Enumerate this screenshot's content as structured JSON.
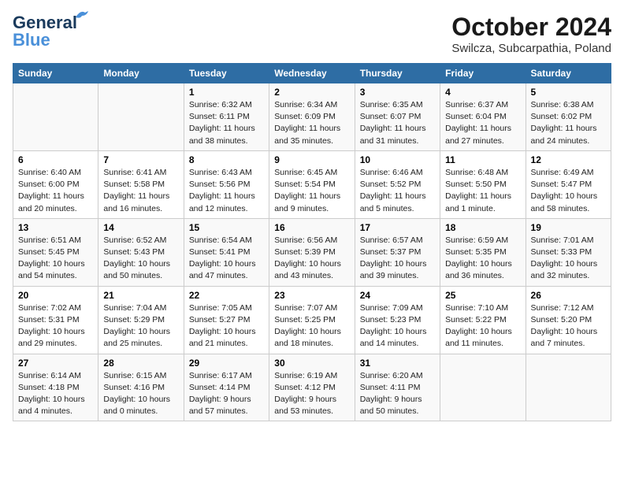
{
  "header": {
    "logo_line1": "General",
    "logo_line2": "Blue",
    "title": "October 2024",
    "subtitle": "Swilcza, Subcarpathia, Poland"
  },
  "days_of_week": [
    "Sunday",
    "Monday",
    "Tuesday",
    "Wednesday",
    "Thursday",
    "Friday",
    "Saturday"
  ],
  "weeks": [
    [
      {
        "day": "",
        "info": ""
      },
      {
        "day": "",
        "info": ""
      },
      {
        "day": "1",
        "info": "Sunrise: 6:32 AM\nSunset: 6:11 PM\nDaylight: 11 hours and 38 minutes."
      },
      {
        "day": "2",
        "info": "Sunrise: 6:34 AM\nSunset: 6:09 PM\nDaylight: 11 hours and 35 minutes."
      },
      {
        "day": "3",
        "info": "Sunrise: 6:35 AM\nSunset: 6:07 PM\nDaylight: 11 hours and 31 minutes."
      },
      {
        "day": "4",
        "info": "Sunrise: 6:37 AM\nSunset: 6:04 PM\nDaylight: 11 hours and 27 minutes."
      },
      {
        "day": "5",
        "info": "Sunrise: 6:38 AM\nSunset: 6:02 PM\nDaylight: 11 hours and 24 minutes."
      }
    ],
    [
      {
        "day": "6",
        "info": "Sunrise: 6:40 AM\nSunset: 6:00 PM\nDaylight: 11 hours and 20 minutes."
      },
      {
        "day": "7",
        "info": "Sunrise: 6:41 AM\nSunset: 5:58 PM\nDaylight: 11 hours and 16 minutes."
      },
      {
        "day": "8",
        "info": "Sunrise: 6:43 AM\nSunset: 5:56 PM\nDaylight: 11 hours and 12 minutes."
      },
      {
        "day": "9",
        "info": "Sunrise: 6:45 AM\nSunset: 5:54 PM\nDaylight: 11 hours and 9 minutes."
      },
      {
        "day": "10",
        "info": "Sunrise: 6:46 AM\nSunset: 5:52 PM\nDaylight: 11 hours and 5 minutes."
      },
      {
        "day": "11",
        "info": "Sunrise: 6:48 AM\nSunset: 5:50 PM\nDaylight: 11 hours and 1 minute."
      },
      {
        "day": "12",
        "info": "Sunrise: 6:49 AM\nSunset: 5:47 PM\nDaylight: 10 hours and 58 minutes."
      }
    ],
    [
      {
        "day": "13",
        "info": "Sunrise: 6:51 AM\nSunset: 5:45 PM\nDaylight: 10 hours and 54 minutes."
      },
      {
        "day": "14",
        "info": "Sunrise: 6:52 AM\nSunset: 5:43 PM\nDaylight: 10 hours and 50 minutes."
      },
      {
        "day": "15",
        "info": "Sunrise: 6:54 AM\nSunset: 5:41 PM\nDaylight: 10 hours and 47 minutes."
      },
      {
        "day": "16",
        "info": "Sunrise: 6:56 AM\nSunset: 5:39 PM\nDaylight: 10 hours and 43 minutes."
      },
      {
        "day": "17",
        "info": "Sunrise: 6:57 AM\nSunset: 5:37 PM\nDaylight: 10 hours and 39 minutes."
      },
      {
        "day": "18",
        "info": "Sunrise: 6:59 AM\nSunset: 5:35 PM\nDaylight: 10 hours and 36 minutes."
      },
      {
        "day": "19",
        "info": "Sunrise: 7:01 AM\nSunset: 5:33 PM\nDaylight: 10 hours and 32 minutes."
      }
    ],
    [
      {
        "day": "20",
        "info": "Sunrise: 7:02 AM\nSunset: 5:31 PM\nDaylight: 10 hours and 29 minutes."
      },
      {
        "day": "21",
        "info": "Sunrise: 7:04 AM\nSunset: 5:29 PM\nDaylight: 10 hours and 25 minutes."
      },
      {
        "day": "22",
        "info": "Sunrise: 7:05 AM\nSunset: 5:27 PM\nDaylight: 10 hours and 21 minutes."
      },
      {
        "day": "23",
        "info": "Sunrise: 7:07 AM\nSunset: 5:25 PM\nDaylight: 10 hours and 18 minutes."
      },
      {
        "day": "24",
        "info": "Sunrise: 7:09 AM\nSunset: 5:23 PM\nDaylight: 10 hours and 14 minutes."
      },
      {
        "day": "25",
        "info": "Sunrise: 7:10 AM\nSunset: 5:22 PM\nDaylight: 10 hours and 11 minutes."
      },
      {
        "day": "26",
        "info": "Sunrise: 7:12 AM\nSunset: 5:20 PM\nDaylight: 10 hours and 7 minutes."
      }
    ],
    [
      {
        "day": "27",
        "info": "Sunrise: 6:14 AM\nSunset: 4:18 PM\nDaylight: 10 hours and 4 minutes."
      },
      {
        "day": "28",
        "info": "Sunrise: 6:15 AM\nSunset: 4:16 PM\nDaylight: 10 hours and 0 minutes."
      },
      {
        "day": "29",
        "info": "Sunrise: 6:17 AM\nSunset: 4:14 PM\nDaylight: 9 hours and 57 minutes."
      },
      {
        "day": "30",
        "info": "Sunrise: 6:19 AM\nSunset: 4:12 PM\nDaylight: 9 hours and 53 minutes."
      },
      {
        "day": "31",
        "info": "Sunrise: 6:20 AM\nSunset: 4:11 PM\nDaylight: 9 hours and 50 minutes."
      },
      {
        "day": "",
        "info": ""
      },
      {
        "day": "",
        "info": ""
      }
    ]
  ]
}
